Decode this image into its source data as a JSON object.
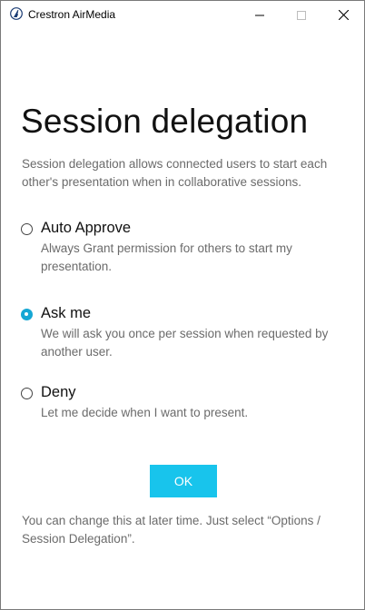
{
  "window": {
    "title": "Crestron AirMedia"
  },
  "dialog": {
    "heading": "Session delegation",
    "intro": "Session delegation allows connected users to start each other's presentation when in collaborative sessions.",
    "options": [
      {
        "label": "Auto Approve",
        "description": "Always Grant permission for others to start my presentation.",
        "selected": false
      },
      {
        "label": "Ask me",
        "description": "We will ask you once per session when requested by another user.",
        "selected": true
      },
      {
        "label": "Deny",
        "description": "Let me decide when I want to present.",
        "selected": false
      }
    ],
    "ok_label": "OK",
    "footer_note": "You can change this at later time. Just select “Options / Session Delegation”."
  },
  "colors": {
    "accent": "#18c4ec",
    "radio_selected": "#16a7d4",
    "secondary_text": "#6b6b6b"
  }
}
